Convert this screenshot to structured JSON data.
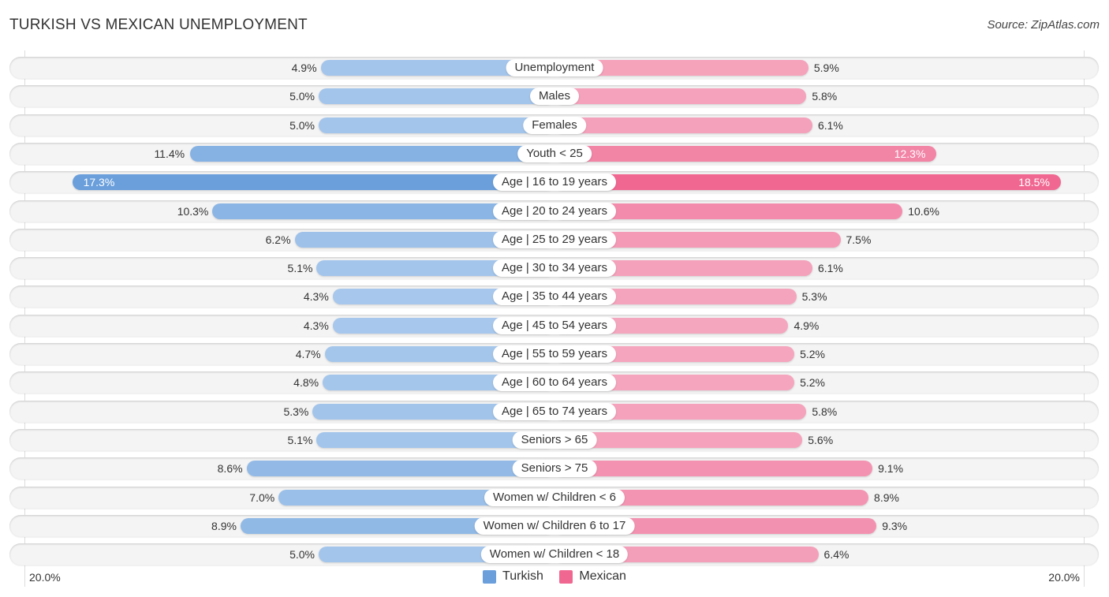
{
  "header": {
    "title": "TURKISH VS MEXICAN UNEMPLOYMENT",
    "source": "Source: ZipAtlas.com"
  },
  "colors": {
    "turkish_light": "#a8c8ec",
    "turkish_strong": "#6a9fdc",
    "mexican_light": "#f5a8c0",
    "mexican_strong": "#f06892"
  },
  "axis": {
    "left_label": "20.0%",
    "right_label": "20.0%"
  },
  "legend": {
    "turkish": "Turkish",
    "mexican": "Mexican"
  },
  "chart_data": {
    "type": "bar",
    "orientation": "horizontal-diverging",
    "title": "TURKISH VS MEXICAN UNEMPLOYMENT",
    "xlim": [
      -20.0,
      20.0
    ],
    "unit": "%",
    "legend_position": "bottom-center",
    "categories": [
      "Unemployment",
      "Males",
      "Females",
      "Youth < 25",
      "Age | 16 to 19 years",
      "Age | 20 to 24 years",
      "Age | 25 to 29 years",
      "Age | 30 to 34 years",
      "Age | 35 to 44 years",
      "Age | 45 to 54 years",
      "Age | 55 to 59 years",
      "Age | 60 to 64 years",
      "Age | 65 to 74 years",
      "Seniors > 65",
      "Seniors > 75",
      "Women w/ Children < 6",
      "Women w/ Children 6 to 17",
      "Women w/ Children < 18"
    ],
    "series": [
      {
        "name": "Turkish",
        "side": "left",
        "values": [
          4.9,
          5.0,
          5.0,
          11.4,
          17.3,
          10.3,
          6.2,
          5.1,
          4.3,
          4.3,
          4.7,
          4.8,
          5.3,
          5.1,
          8.6,
          7.0,
          8.9,
          5.0
        ],
        "labels": [
          "4.9%",
          "5.0%",
          "5.0%",
          "11.4%",
          "17.3%",
          "10.3%",
          "6.2%",
          "5.1%",
          "4.3%",
          "4.3%",
          "4.7%",
          "4.8%",
          "5.3%",
          "5.1%",
          "8.6%",
          "7.0%",
          "8.9%",
          "5.0%"
        ]
      },
      {
        "name": "Mexican",
        "side": "right",
        "values": [
          5.9,
          5.8,
          6.1,
          12.3,
          18.5,
          10.6,
          7.5,
          6.1,
          5.3,
          4.9,
          5.2,
          5.2,
          5.8,
          5.6,
          9.1,
          8.9,
          9.3,
          6.4
        ],
        "labels": [
          "5.9%",
          "5.8%",
          "6.1%",
          "12.3%",
          "18.5%",
          "10.6%",
          "7.5%",
          "6.1%",
          "5.3%",
          "4.9%",
          "5.2%",
          "5.2%",
          "5.8%",
          "5.6%",
          "9.1%",
          "8.9%",
          "9.3%",
          "6.4%"
        ]
      }
    ]
  }
}
